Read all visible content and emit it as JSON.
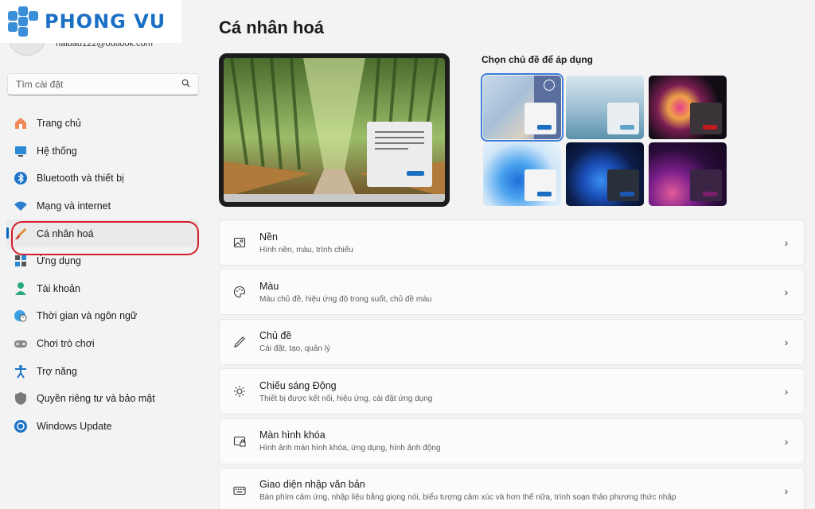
{
  "logo": {
    "text": "PHONG VU"
  },
  "account": {
    "email": "haibau122@outlook.com"
  },
  "search": {
    "placeholder": "Tìm cài đặt"
  },
  "nav": [
    {
      "label": "Trang chủ",
      "icon": "home-icon"
    },
    {
      "label": "Hệ thống",
      "icon": "monitor-icon"
    },
    {
      "label": "Bluetooth và thiết bị",
      "icon": "bluetooth-icon"
    },
    {
      "label": "Mạng và internet",
      "icon": "wifi-icon"
    },
    {
      "label": "Cá nhân hoá",
      "icon": "brush-icon",
      "active": true
    },
    {
      "label": "Ứng dụng",
      "icon": "apps-icon"
    },
    {
      "label": "Tài khoản",
      "icon": "person-icon"
    },
    {
      "label": "Thời gian và ngôn ngữ",
      "icon": "globe-clock-icon"
    },
    {
      "label": "Chơi trò chơi",
      "icon": "gamepad-icon"
    },
    {
      "label": "Trợ năng",
      "icon": "accessibility-icon"
    },
    {
      "label": "Quyền riêng tư và bảo mật",
      "icon": "shield-icon"
    },
    {
      "label": "Windows Update",
      "icon": "update-icon"
    }
  ],
  "main": {
    "title": "Cá nhân hoá",
    "themes_title": "Chọn chủ đề để áp dụng",
    "themes": [
      {
        "name": "theme-windows-spotlight",
        "selected": true,
        "accent": "#1c6fc0"
      },
      {
        "name": "theme-glow-lake",
        "accent": "#5fa3c9"
      },
      {
        "name": "theme-flower-dark",
        "accent": "#c2181f"
      },
      {
        "name": "theme-windows-light",
        "accent": "#1c6fc0"
      },
      {
        "name": "theme-windows-dark",
        "accent": "#1c57b0"
      },
      {
        "name": "theme-captured-motion",
        "accent": "#7a1f6e"
      }
    ],
    "settings": [
      {
        "title": "Nền",
        "subtitle": "Hình nền, màu, trình chiếu",
        "icon": "image-icon"
      },
      {
        "title": "Màu",
        "subtitle": "Màu chủ đề, hiệu ứng độ trong suốt, chủ đề màu",
        "icon": "palette-icon"
      },
      {
        "title": "Chủ đề",
        "subtitle": "Cài đặt, tạo, quản lý",
        "icon": "pen-icon"
      },
      {
        "title": "Chiếu sáng Động",
        "subtitle": "Thiết bị được kết nối, hiệu ứng, cài đặt ứng dụng",
        "icon": "lighting-icon"
      },
      {
        "title": "Màn hình khóa",
        "subtitle": "Hình ảnh màn hình khóa, ứng dụng, hình ảnh động",
        "icon": "lock-screen-icon"
      },
      {
        "title": "Giao diện nhập văn bản",
        "subtitle": "Bàn phím cảm ứng, nhập liệu bằng giọng nói, biểu tượng cảm xúc và hơn thế nữa, trình soạn thảo phương thức nhập",
        "icon": "keyboard-icon"
      }
    ]
  },
  "colors": {
    "accent": "#0067c0",
    "annotation": "#d21f2a",
    "logo": "#1b6fc4"
  }
}
